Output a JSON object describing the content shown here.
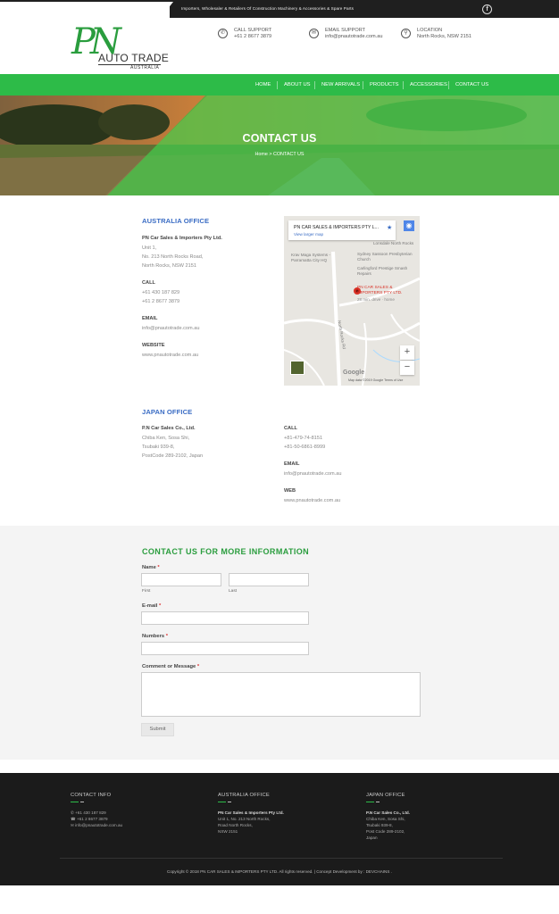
{
  "topbar": {
    "tagline": "Importers, Wholesaler & Retailers Of Construction Machinery & Accessories & Spare Parts",
    "social_icon": "facebook-icon",
    "social_glyph": "f"
  },
  "logo": {
    "pn": "PN",
    "name": "AUTO TRADE",
    "country": "AUSTRALIA"
  },
  "header_contacts": [
    {
      "icon": "phone-icon",
      "glyph": "✆",
      "title": "CALL SUPPORT",
      "value": "+61 2 8677 3879"
    },
    {
      "icon": "email-icon",
      "glyph": "✉",
      "title": "EMAIL SUPPORT",
      "value": "info@pnautotrade.com.au"
    },
    {
      "icon": "location-icon",
      "glyph": "⚲",
      "title": "LOCATION",
      "value": "North Rocks, NSW 2151"
    }
  ],
  "nav": [
    "HOME",
    "ABOUT US",
    "NEW ARRIVALS",
    "PRODUCTS",
    "ACCESSORIES",
    "CONTACT US"
  ],
  "hero": {
    "title": "CONTACT US",
    "breadcrumb": "Home  >  CONTACT US"
  },
  "australia": {
    "heading": "AUSTRALIA OFFICE",
    "company": "PN Car Sales & Importers Pty Ltd.",
    "address": [
      "Unit 1,",
      "No. 213 North Rocks Road,",
      "North Rocks, NSW 2151"
    ],
    "call_label": "CALL",
    "call": [
      "+61 430 187 829",
      "+61 2 8677 3879"
    ],
    "email_label": "EMAIL",
    "email": "info@pnautotrade.com.au",
    "website_label": "WEBSITE",
    "website": "www.pnautotrade.com.au"
  },
  "map": {
    "card_title": "PN CAR SALES & IMPORTERS PTY L...",
    "card_link": "View larger map",
    "places": [
      "Lonsdale North Rocks",
      "Krav Maga Systems - Parramatta City HQ",
      "Sydney Sassoon Presbyterian Church",
      "Carlingford Prestige Smash Repairs",
      "North Rocks Rd"
    ],
    "pin_label": "PN CAR SALES & IMPORTERS PTY LTD.",
    "pin_sub": "28 min. drive · home",
    "google": "Google",
    "footer": "Map data ©2019 Google   Terms of Use",
    "zoom_in": "+",
    "zoom_out": "−"
  },
  "japan": {
    "heading": "JAPAN OFFICE",
    "company": "P.N Car Sales Co., Ltd.",
    "address": [
      "Chiba Ken, Sosa Shi,",
      "Tsubaki 939-8,",
      "PostCode 289-2102, Japan"
    ],
    "call_label": "CALL",
    "call": [
      "+81-479-74-8151",
      "+81-50-6861-8999"
    ],
    "email_label": "EMAIL",
    "email": "info@pnautotrade.com.au",
    "web_label": "WEB",
    "web": "www.pnautotrade.com.au"
  },
  "form": {
    "title": "CONTACT US FOR MORE INFORMATION",
    "name_label": "Name",
    "first": "First",
    "last": "Last",
    "email_label": "E-mail",
    "numbers_label": "Numbers",
    "comment_label": "Comment or Message",
    "required": "*",
    "submit": "Submit"
  },
  "footer": {
    "contact_title": "CONTACT INFO",
    "contact_lines": [
      "✆ +61 430 187 829",
      "☎ +61 2 8677 3879",
      "✉ info@pnautotrade.com.au"
    ],
    "au_title": "AUSTRALIA OFFICE",
    "au_company": "PN Car Sales & Importers Pty Ltd.",
    "au_lines": [
      "Unit 1, No. 213 North Rocks,",
      "Road North Rocks,",
      "NSW 2151"
    ],
    "jp_title": "JAPAN OFFICE",
    "jp_company": "P.N Car Sales Co., Ltd.",
    "jp_lines": [
      "Chiba Ken, Sosa Shi,",
      "Tsubaki 939-8,",
      "Post Code 289-2102,",
      "Japan"
    ],
    "copyright": "Copyright © 2018 PN CAR SALES & IMPORTERS PTY LTD. All rights reserved. | Concept Development by : DEVCHAINS ."
  }
}
